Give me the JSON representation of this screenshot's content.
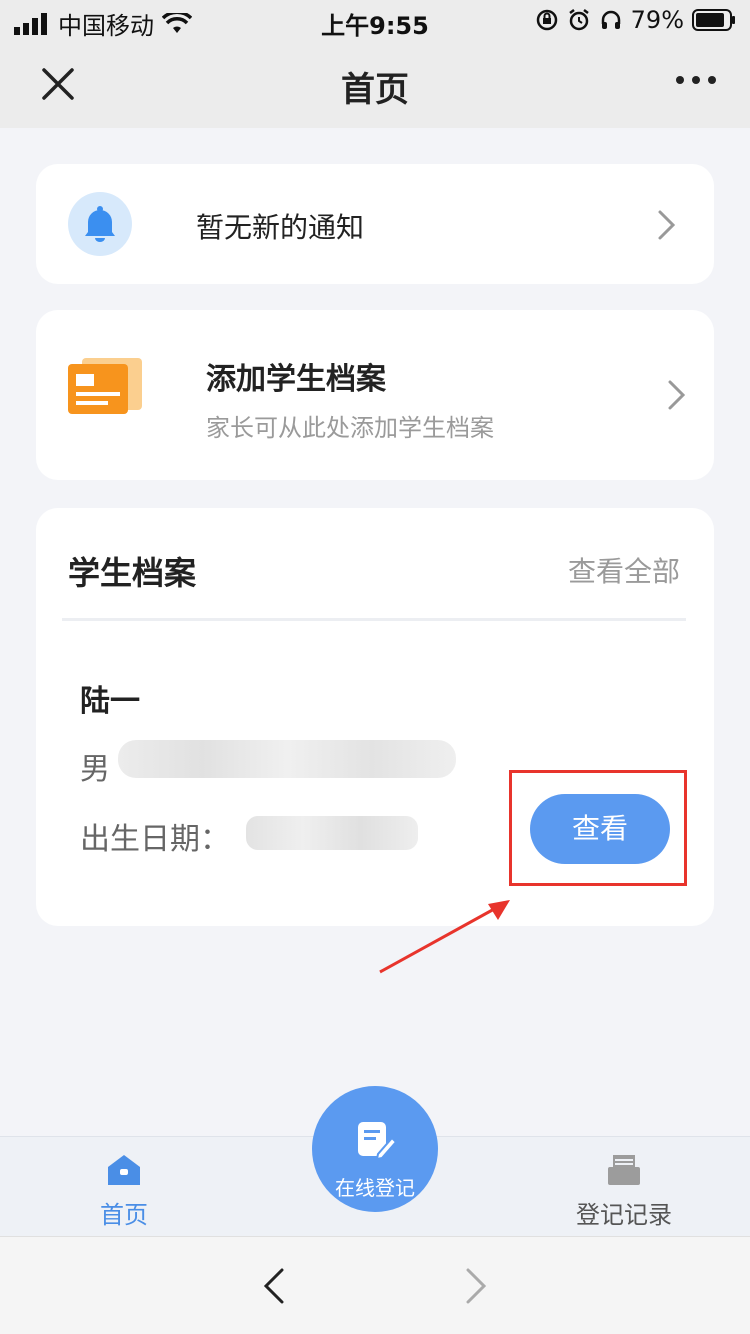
{
  "status_bar": {
    "carrier": "中国移动",
    "time": "上午9:55",
    "battery": "79%"
  },
  "navbar": {
    "title": "首页"
  },
  "notice": {
    "text": "暂无新的通知"
  },
  "add_archive": {
    "title": "添加学生档案",
    "subtitle": "家长可从此处添加学生档案"
  },
  "archive": {
    "title": "学生档案",
    "view_all": "查看全部",
    "student": {
      "name": "陆一",
      "gender": "男",
      "dob_label": "出生日期：",
      "view_button": "查看"
    }
  },
  "tabbar": {
    "home": "首页",
    "register": "在线登记",
    "records": "登记记录"
  },
  "colors": {
    "accent": "#5b9af0",
    "highlight": "#e8342c",
    "doc_icon": "#f7941d"
  }
}
